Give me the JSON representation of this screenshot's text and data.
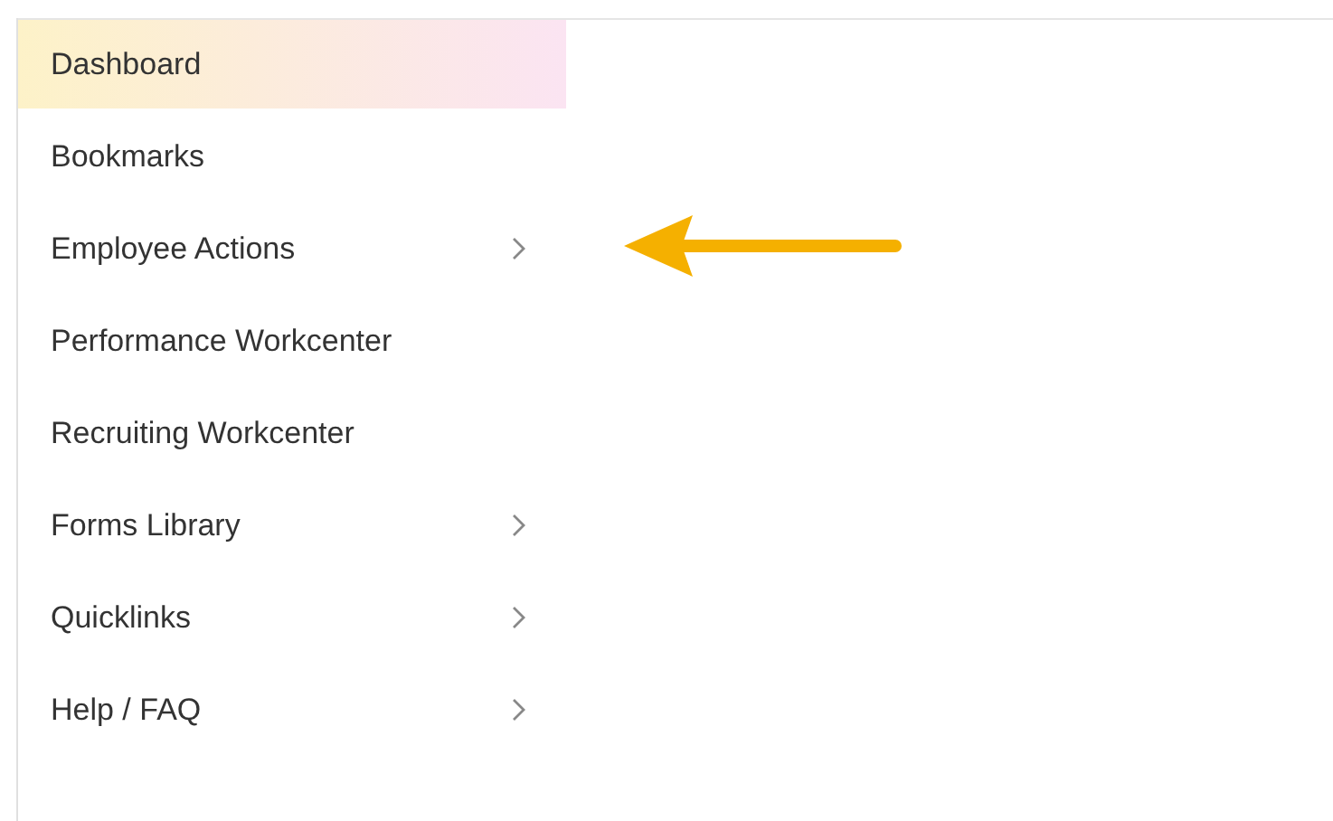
{
  "menu": {
    "items": [
      {
        "label": "Dashboard",
        "selected": true,
        "has_submenu": false
      },
      {
        "label": "Bookmarks",
        "selected": false,
        "has_submenu": false
      },
      {
        "label": "Employee Actions",
        "selected": false,
        "has_submenu": true
      },
      {
        "label": "Performance Workcenter",
        "selected": false,
        "has_submenu": false
      },
      {
        "label": "Recruiting Workcenter",
        "selected": false,
        "has_submenu": false
      },
      {
        "label": "Forms Library",
        "selected": false,
        "has_submenu": true
      },
      {
        "label": "Quicklinks",
        "selected": false,
        "has_submenu": true
      },
      {
        "label": "Help / FAQ",
        "selected": false,
        "has_submenu": true
      }
    ]
  }
}
